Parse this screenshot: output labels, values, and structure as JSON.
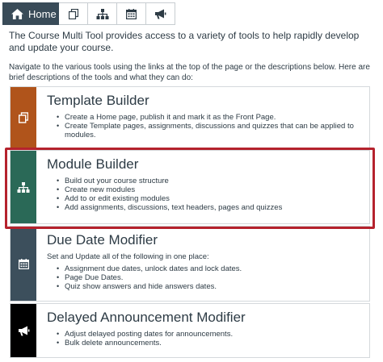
{
  "nav": {
    "home_label": "Home",
    "items": [
      {
        "icon": "copy-icon"
      },
      {
        "icon": "sitemap-icon"
      },
      {
        "icon": "calendar-icon"
      },
      {
        "icon": "megaphone-icon"
      }
    ]
  },
  "intro": {
    "paragraph1": "The Course Multi Tool provides access to a variety of tools to help rapidly develop and update your course.",
    "paragraph2": "Navigate to the various tools using the links at the top of the page or the descriptions below. Here are brief descriptions of the tools and what they can do:"
  },
  "tools": [
    {
      "title": "Template Builder",
      "color": "#b0541b",
      "icon": "copy-icon",
      "lead": "",
      "bullets": [
        "Create a Home page, publish it and mark it as the Front Page.",
        "Create Template pages, assignments, discussions and quizzes that can be applied to modules."
      ]
    },
    {
      "title": "Module Builder",
      "color": "#2a6957",
      "icon": "sitemap-icon",
      "lead": "",
      "bullets": [
        "Build out your course structure",
        "Create new modules",
        "Add to or edit existing modules",
        "Add assignments, discussions, text headers, pages and quizzes"
      ]
    },
    {
      "title": "Due Date Modifier",
      "color": "#3c4f5c",
      "icon": "calendar-icon",
      "lead": "Set and Update all of the following in one place:",
      "bullets": [
        "Assignment due dates, unlock dates and lock dates.",
        "Page Due Dates.",
        "Quiz show answers and hide answers dates."
      ]
    },
    {
      "title": "Delayed Announcement Modifier",
      "color": "#000000",
      "icon": "megaphone-icon",
      "lead": "",
      "bullets": [
        "Adjust delayed posting dates for announcements.",
        "Bulk delete announcements."
      ]
    }
  ],
  "highlight_color": "#b5222d"
}
